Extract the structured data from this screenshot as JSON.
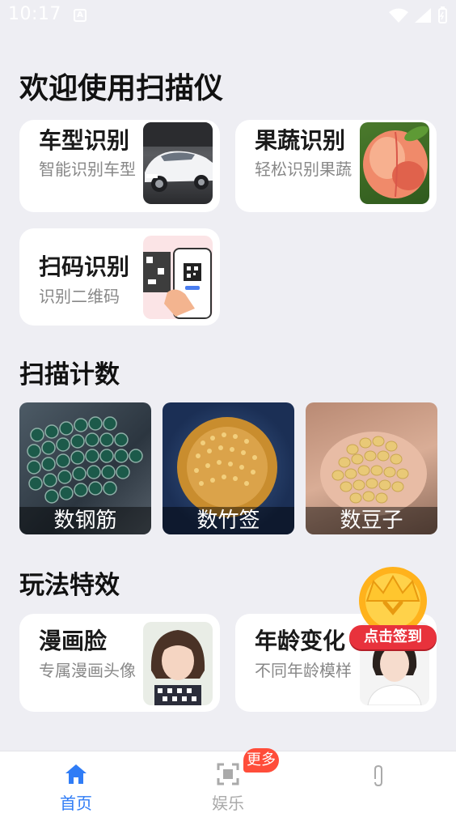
{
  "status": {
    "time": "10:17",
    "a_glyph": "A"
  },
  "page_title": "欢迎使用扫描仪",
  "recognition_cards": [
    {
      "title": "车型识别",
      "subtitle": "智能识别车型"
    },
    {
      "title": "果蔬识别",
      "subtitle": "轻松识别果蔬"
    },
    {
      "title": "扫码识别",
      "subtitle": "识别二维码"
    }
  ],
  "count_section": {
    "title": "扫描计数",
    "tiles": [
      {
        "label": "数钢筋"
      },
      {
        "label": "数竹签"
      },
      {
        "label": "数豆子"
      }
    ]
  },
  "effects_section": {
    "title": "玩法特效",
    "cards": [
      {
        "title": "漫画脸",
        "subtitle": "专属漫画头像"
      },
      {
        "title": "年龄变化",
        "subtitle": "不同年龄模样"
      }
    ]
  },
  "signin": {
    "label": "点击签到"
  },
  "nav": {
    "items": [
      {
        "label": "首页"
      },
      {
        "label": "娱乐"
      }
    ],
    "badge": "更多",
    "active_color": "#2f7cf6",
    "inactive_color": "#aaaaaa"
  }
}
